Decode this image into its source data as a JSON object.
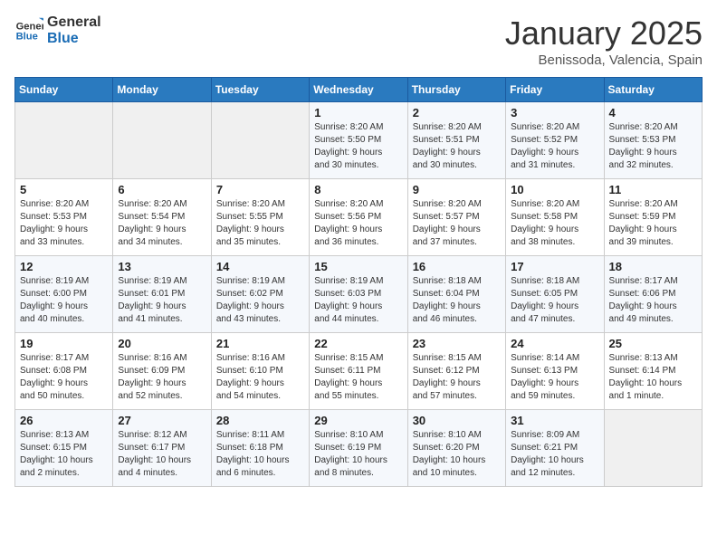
{
  "logo": {
    "line1": "General",
    "line2": "Blue"
  },
  "calendar": {
    "title": "January 2025",
    "subtitle": "Benissoda, Valencia, Spain"
  },
  "headers": [
    "Sunday",
    "Monday",
    "Tuesday",
    "Wednesday",
    "Thursday",
    "Friday",
    "Saturday"
  ],
  "weeks": [
    [
      {
        "day": "",
        "info": ""
      },
      {
        "day": "",
        "info": ""
      },
      {
        "day": "",
        "info": ""
      },
      {
        "day": "1",
        "info": "Sunrise: 8:20 AM\nSunset: 5:50 PM\nDaylight: 9 hours\nand 30 minutes."
      },
      {
        "day": "2",
        "info": "Sunrise: 8:20 AM\nSunset: 5:51 PM\nDaylight: 9 hours\nand 30 minutes."
      },
      {
        "day": "3",
        "info": "Sunrise: 8:20 AM\nSunset: 5:52 PM\nDaylight: 9 hours\nand 31 minutes."
      },
      {
        "day": "4",
        "info": "Sunrise: 8:20 AM\nSunset: 5:53 PM\nDaylight: 9 hours\nand 32 minutes."
      }
    ],
    [
      {
        "day": "5",
        "info": "Sunrise: 8:20 AM\nSunset: 5:53 PM\nDaylight: 9 hours\nand 33 minutes."
      },
      {
        "day": "6",
        "info": "Sunrise: 8:20 AM\nSunset: 5:54 PM\nDaylight: 9 hours\nand 34 minutes."
      },
      {
        "day": "7",
        "info": "Sunrise: 8:20 AM\nSunset: 5:55 PM\nDaylight: 9 hours\nand 35 minutes."
      },
      {
        "day": "8",
        "info": "Sunrise: 8:20 AM\nSunset: 5:56 PM\nDaylight: 9 hours\nand 36 minutes."
      },
      {
        "day": "9",
        "info": "Sunrise: 8:20 AM\nSunset: 5:57 PM\nDaylight: 9 hours\nand 37 minutes."
      },
      {
        "day": "10",
        "info": "Sunrise: 8:20 AM\nSunset: 5:58 PM\nDaylight: 9 hours\nand 38 minutes."
      },
      {
        "day": "11",
        "info": "Sunrise: 8:20 AM\nSunset: 5:59 PM\nDaylight: 9 hours\nand 39 minutes."
      }
    ],
    [
      {
        "day": "12",
        "info": "Sunrise: 8:19 AM\nSunset: 6:00 PM\nDaylight: 9 hours\nand 40 minutes."
      },
      {
        "day": "13",
        "info": "Sunrise: 8:19 AM\nSunset: 6:01 PM\nDaylight: 9 hours\nand 41 minutes."
      },
      {
        "day": "14",
        "info": "Sunrise: 8:19 AM\nSunset: 6:02 PM\nDaylight: 9 hours\nand 43 minutes."
      },
      {
        "day": "15",
        "info": "Sunrise: 8:19 AM\nSunset: 6:03 PM\nDaylight: 9 hours\nand 44 minutes."
      },
      {
        "day": "16",
        "info": "Sunrise: 8:18 AM\nSunset: 6:04 PM\nDaylight: 9 hours\nand 46 minutes."
      },
      {
        "day": "17",
        "info": "Sunrise: 8:18 AM\nSunset: 6:05 PM\nDaylight: 9 hours\nand 47 minutes."
      },
      {
        "day": "18",
        "info": "Sunrise: 8:17 AM\nSunset: 6:06 PM\nDaylight: 9 hours\nand 49 minutes."
      }
    ],
    [
      {
        "day": "19",
        "info": "Sunrise: 8:17 AM\nSunset: 6:08 PM\nDaylight: 9 hours\nand 50 minutes."
      },
      {
        "day": "20",
        "info": "Sunrise: 8:16 AM\nSunset: 6:09 PM\nDaylight: 9 hours\nand 52 minutes."
      },
      {
        "day": "21",
        "info": "Sunrise: 8:16 AM\nSunset: 6:10 PM\nDaylight: 9 hours\nand 54 minutes."
      },
      {
        "day": "22",
        "info": "Sunrise: 8:15 AM\nSunset: 6:11 PM\nDaylight: 9 hours\nand 55 minutes."
      },
      {
        "day": "23",
        "info": "Sunrise: 8:15 AM\nSunset: 6:12 PM\nDaylight: 9 hours\nand 57 minutes."
      },
      {
        "day": "24",
        "info": "Sunrise: 8:14 AM\nSunset: 6:13 PM\nDaylight: 9 hours\nand 59 minutes."
      },
      {
        "day": "25",
        "info": "Sunrise: 8:13 AM\nSunset: 6:14 PM\nDaylight: 10 hours\nand 1 minute."
      }
    ],
    [
      {
        "day": "26",
        "info": "Sunrise: 8:13 AM\nSunset: 6:15 PM\nDaylight: 10 hours\nand 2 minutes."
      },
      {
        "day": "27",
        "info": "Sunrise: 8:12 AM\nSunset: 6:17 PM\nDaylight: 10 hours\nand 4 minutes."
      },
      {
        "day": "28",
        "info": "Sunrise: 8:11 AM\nSunset: 6:18 PM\nDaylight: 10 hours\nand 6 minutes."
      },
      {
        "day": "29",
        "info": "Sunrise: 8:10 AM\nSunset: 6:19 PM\nDaylight: 10 hours\nand 8 minutes."
      },
      {
        "day": "30",
        "info": "Sunrise: 8:10 AM\nSunset: 6:20 PM\nDaylight: 10 hours\nand 10 minutes."
      },
      {
        "day": "31",
        "info": "Sunrise: 8:09 AM\nSunset: 6:21 PM\nDaylight: 10 hours\nand 12 minutes."
      },
      {
        "day": "",
        "info": ""
      }
    ]
  ]
}
